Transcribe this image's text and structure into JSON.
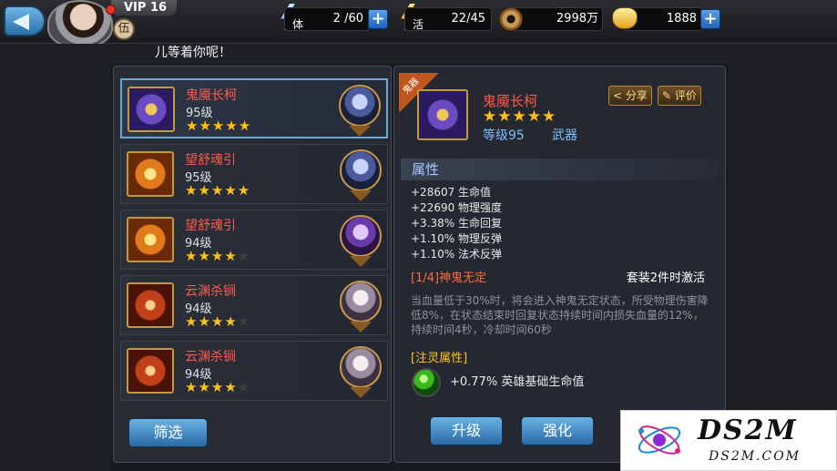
{
  "header": {
    "vip": "VIP 16",
    "level_badge": "伍",
    "stamina": {
      "label": "体",
      "value": "2 /60"
    },
    "vigor": {
      "label": "活",
      "value": "22/45"
    },
    "coins": "2998万",
    "ingots": "1888",
    "plus_label": "+"
  },
  "marquee": "儿等着你呢！",
  "equipment_list": [
    {
      "name": "鬼魇长柯",
      "level": "95级",
      "stars": 5,
      "icon": "purple-axe-icon",
      "portrait": "hero-portrait-blue"
    },
    {
      "name": "望舒魂引",
      "level": "95级",
      "stars": 5,
      "icon": "orange-blade-icon",
      "portrait": "hero-portrait-blue"
    },
    {
      "name": "望舒魂引",
      "level": "94级",
      "stars": 4,
      "icon": "orange-blade-icon",
      "portrait": "hero-portrait-violet"
    },
    {
      "name": "云渊杀锏",
      "level": "94级",
      "stars": 4,
      "icon": "red-mace-icon",
      "portrait": "hero-portrait-silver"
    },
    {
      "name": "云渊杀锏",
      "level": "94级",
      "stars": 4,
      "icon": "red-mace-icon",
      "portrait": "hero-portrait-silver"
    }
  ],
  "filter_label": "筛选",
  "detail": {
    "ribbon": "鬼器",
    "name": "鬼魇长柯",
    "stars": 5,
    "level": "等级95",
    "type": "武器",
    "share_label": "分享",
    "review_label": "评价",
    "section_title": "属性",
    "attributes": [
      "+28607 生命值",
      "+22690 物理强度",
      "+3.38% 生命回复",
      "+1.10% 物理反弹",
      "+1.10% 法术反弹"
    ],
    "set_title": "[1/4]神鬼无定",
    "set_condition": "套装2件时激活",
    "set_description": "当血量低于30%时，将会进入神鬼无定状态，所受物理伤害降低8%，在状态结束时回复状态持续时间内损失血量的12%，持续时间4秒，冷却时间60秒",
    "spirit_title": "[注灵属性]",
    "spirit_value": "+0.77% 英雄基础生命值"
  },
  "actions": {
    "upgrade": "升级",
    "enhance": "强化"
  },
  "watermark": {
    "title": "DS2M",
    "subtitle": "DS2M.COM"
  },
  "colors": {
    "accent_blue": "#2a6aa6",
    "item_name_red": "#ff5a4a",
    "star_gold": "#ffc21a"
  }
}
